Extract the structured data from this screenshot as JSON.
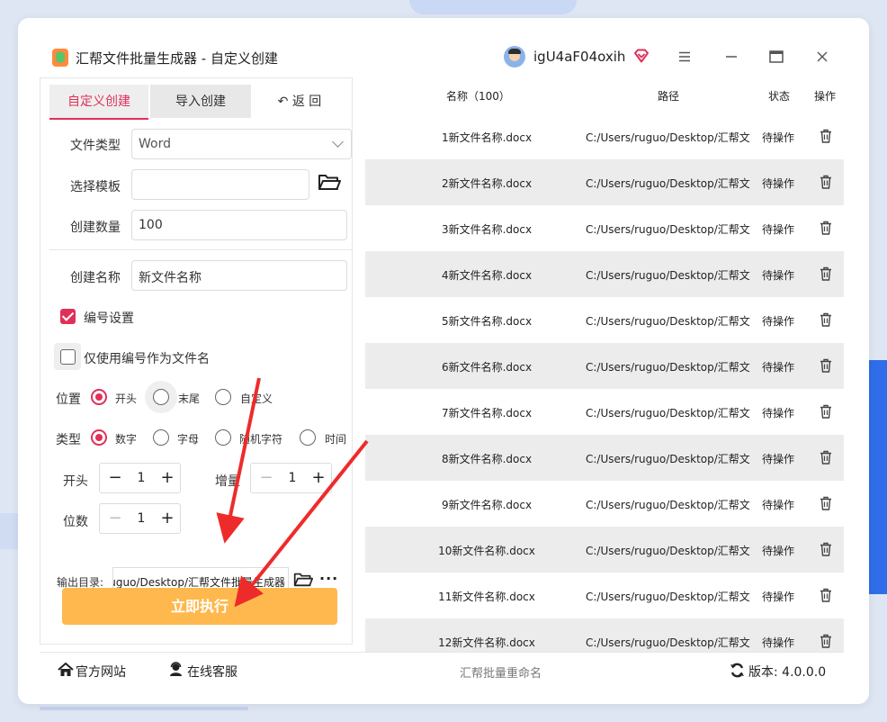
{
  "window": {
    "title": "汇帮文件批量生成器 - 自定义创建",
    "user_name": "igU4aF04oxih"
  },
  "tabs": {
    "custom": "自定义创建",
    "import": "导入创建",
    "back": "↶ 返 回"
  },
  "form": {
    "file_type_label": "文件类型",
    "file_type_value": "Word",
    "template_label": "选择模板",
    "template_value": "",
    "count_label": "创建数量",
    "count_value": "100",
    "name_label": "创建名称",
    "name_value": "新文件名称",
    "numbering_label": "编号设置",
    "numbering_checked": true,
    "only_number_label": "仅使用编号作为文件名",
    "only_number_checked": false,
    "position_label": "位置",
    "position_options": [
      "开头",
      "末尾",
      "自定义"
    ],
    "position_selected": "开头",
    "type_label": "类型",
    "type_options": [
      "数字",
      "字母",
      "随机字符",
      "时间"
    ],
    "type_selected": "数字",
    "start_label": "开头",
    "start_value": "1",
    "increment_label": "增量",
    "increment_value": "1",
    "digits_label": "位数",
    "digits_value": "1",
    "output_label": "输出目录:",
    "output_value": "C:/Users/ruguo/Desktop/汇帮文件批量生成器",
    "execute_label": "立即执行"
  },
  "table": {
    "headers": {
      "name": "名称（100）",
      "path": "路径",
      "status": "状态",
      "action": "操作"
    },
    "rows": [
      {
        "name": "1新文件名称.docx",
        "path": "C:/Users/ruguo/Desktop/汇帮文",
        "status": "待操作"
      },
      {
        "name": "2新文件名称.docx",
        "path": "C:/Users/ruguo/Desktop/汇帮文",
        "status": "待操作"
      },
      {
        "name": "3新文件名称.docx",
        "path": "C:/Users/ruguo/Desktop/汇帮文",
        "status": "待操作"
      },
      {
        "name": "4新文件名称.docx",
        "path": "C:/Users/ruguo/Desktop/汇帮文",
        "status": "待操作"
      },
      {
        "name": "5新文件名称.docx",
        "path": "C:/Users/ruguo/Desktop/汇帮文",
        "status": "待操作"
      },
      {
        "name": "6新文件名称.docx",
        "path": "C:/Users/ruguo/Desktop/汇帮文",
        "status": "待操作"
      },
      {
        "name": "7新文件名称.docx",
        "path": "C:/Users/ruguo/Desktop/汇帮文",
        "status": "待操作"
      },
      {
        "name": "8新文件名称.docx",
        "path": "C:/Users/ruguo/Desktop/汇帮文",
        "status": "待操作"
      },
      {
        "name": "9新文件名称.docx",
        "path": "C:/Users/ruguo/Desktop/汇帮文",
        "status": "待操作"
      },
      {
        "name": "10新文件名称.docx",
        "path": "C:/Users/ruguo/Desktop/汇帮文",
        "status": "待操作"
      },
      {
        "name": "11新文件名称.docx",
        "path": "C:/Users/ruguo/Desktop/汇帮文",
        "status": "待操作"
      },
      {
        "name": "12新文件名称.docx",
        "path": "C:/Users/ruguo/Desktop/汇帮文",
        "status": "待操作"
      }
    ]
  },
  "footer": {
    "website": "官方网站",
    "service": "在线客服",
    "center": "汇帮批量重命名",
    "version": "版本:  4.0.0.0"
  },
  "colors": {
    "accent": "#e0305a",
    "execute_button": "#ffb84d",
    "annotation_arrow": "#ee2b2b"
  }
}
